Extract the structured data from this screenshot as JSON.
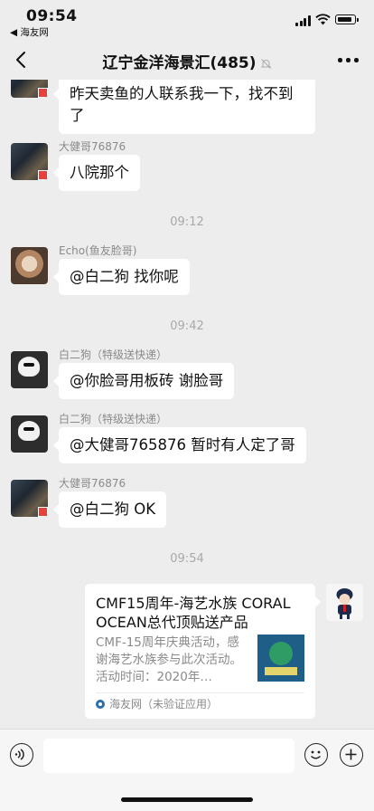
{
  "status_bar": {
    "time": "09:54",
    "back_app": "◀ 海友网"
  },
  "nav": {
    "title": "辽宁金洋海景汇(485)"
  },
  "messages": [
    {
      "sender": "",
      "text": "昨天卖鱼的人联系我一下，找不到了"
    },
    {
      "sender": "大健哥76876",
      "text": "八院那个"
    },
    {
      "sender": "Echo(鱼友脸哥)",
      "text": "@白二狗 找你呢"
    },
    {
      "sender": "白二狗（特级送快递）",
      "text": "@你脸哥用板砖 谢脸哥"
    },
    {
      "sender": "白二狗（特级送快递）",
      "text": "@大健哥765876 暂时有人定了哥"
    },
    {
      "sender": "大健哥76876",
      "text": "@白二狗 OK"
    }
  ],
  "timestamps": [
    "09:12",
    "09:42",
    "09:54"
  ],
  "card": {
    "title": "CMF15周年-海艺水族 CORAL OCEAN总代顶贴送产品",
    "description": "CMF-15周年庆典活动，感谢海艺水族参与此次活动。活动时间：2020年…",
    "source": "海友网（未验证应用）"
  },
  "colors": {
    "background": "#ededed",
    "bubble": "#ffffff",
    "flag": "#e8403b"
  }
}
